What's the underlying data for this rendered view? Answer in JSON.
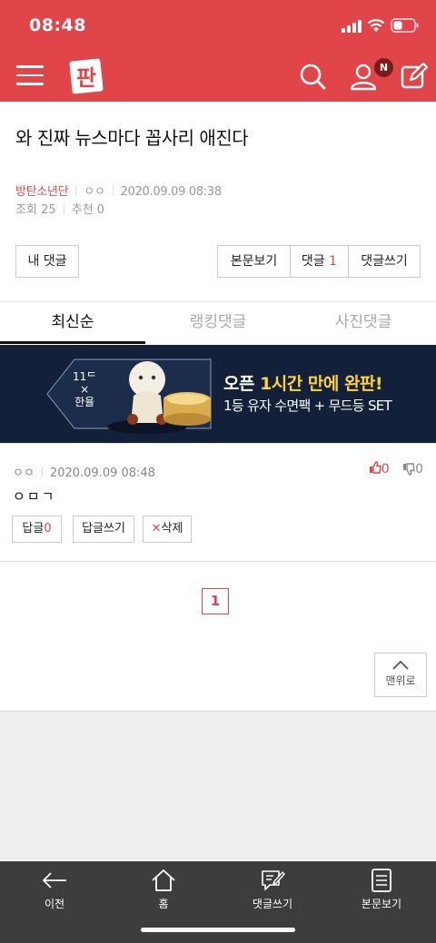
{
  "status_bar": {
    "time": "08:48"
  },
  "header": {
    "logo_text": "판",
    "notification_badge": "N",
    "brand_color": "#e0454a"
  },
  "post": {
    "title": "와 진짜 뉴스마다 꼽사리 애진다",
    "author": "방탄소년단",
    "nickname": "ㅇㅇ",
    "date": "2020.09.09 08:38",
    "views_label": "조회",
    "views": "25",
    "recommend_label": "추천",
    "recommend": "0"
  },
  "actions": {
    "my_comments": "내 댓글",
    "view_body": "본문보기",
    "comments_label": "댓글",
    "comments_count": "1",
    "write_comment": "댓글쓰기"
  },
  "tabs": [
    {
      "label": "최신순",
      "active": true
    },
    {
      "label": "랭킹댓글",
      "active": false
    },
    {
      "label": "사진댓글",
      "active": false
    }
  ],
  "banner": {
    "brand_line1": "11ᄃ",
    "brand_line2": "×",
    "brand_line3": "한율",
    "headline_pre": "오픈 ",
    "headline_highlight": "1시간 만에 완판!",
    "subline": "1등 유자 수면팩 + 무드등 SET"
  },
  "comment": {
    "nickname": "ㅇㅇ",
    "date": "2020.09.09 08:48",
    "upvotes": "0",
    "downvotes": "0",
    "body": "ㅇㅁㄱ",
    "reply_label": "답글",
    "reply_count": "0",
    "write_reply": "답글쓰기",
    "delete_icon": "✕",
    "delete_label": "삭제"
  },
  "pagination": {
    "current": "1"
  },
  "to_top": {
    "label": "맨위로"
  },
  "bottom_nav": [
    {
      "label": "이전",
      "icon": "back-arrow-icon"
    },
    {
      "label": "홈",
      "icon": "home-icon"
    },
    {
      "label": "댓글쓰기",
      "icon": "write-comment-icon"
    },
    {
      "label": "본문보기",
      "icon": "document-icon"
    }
  ]
}
